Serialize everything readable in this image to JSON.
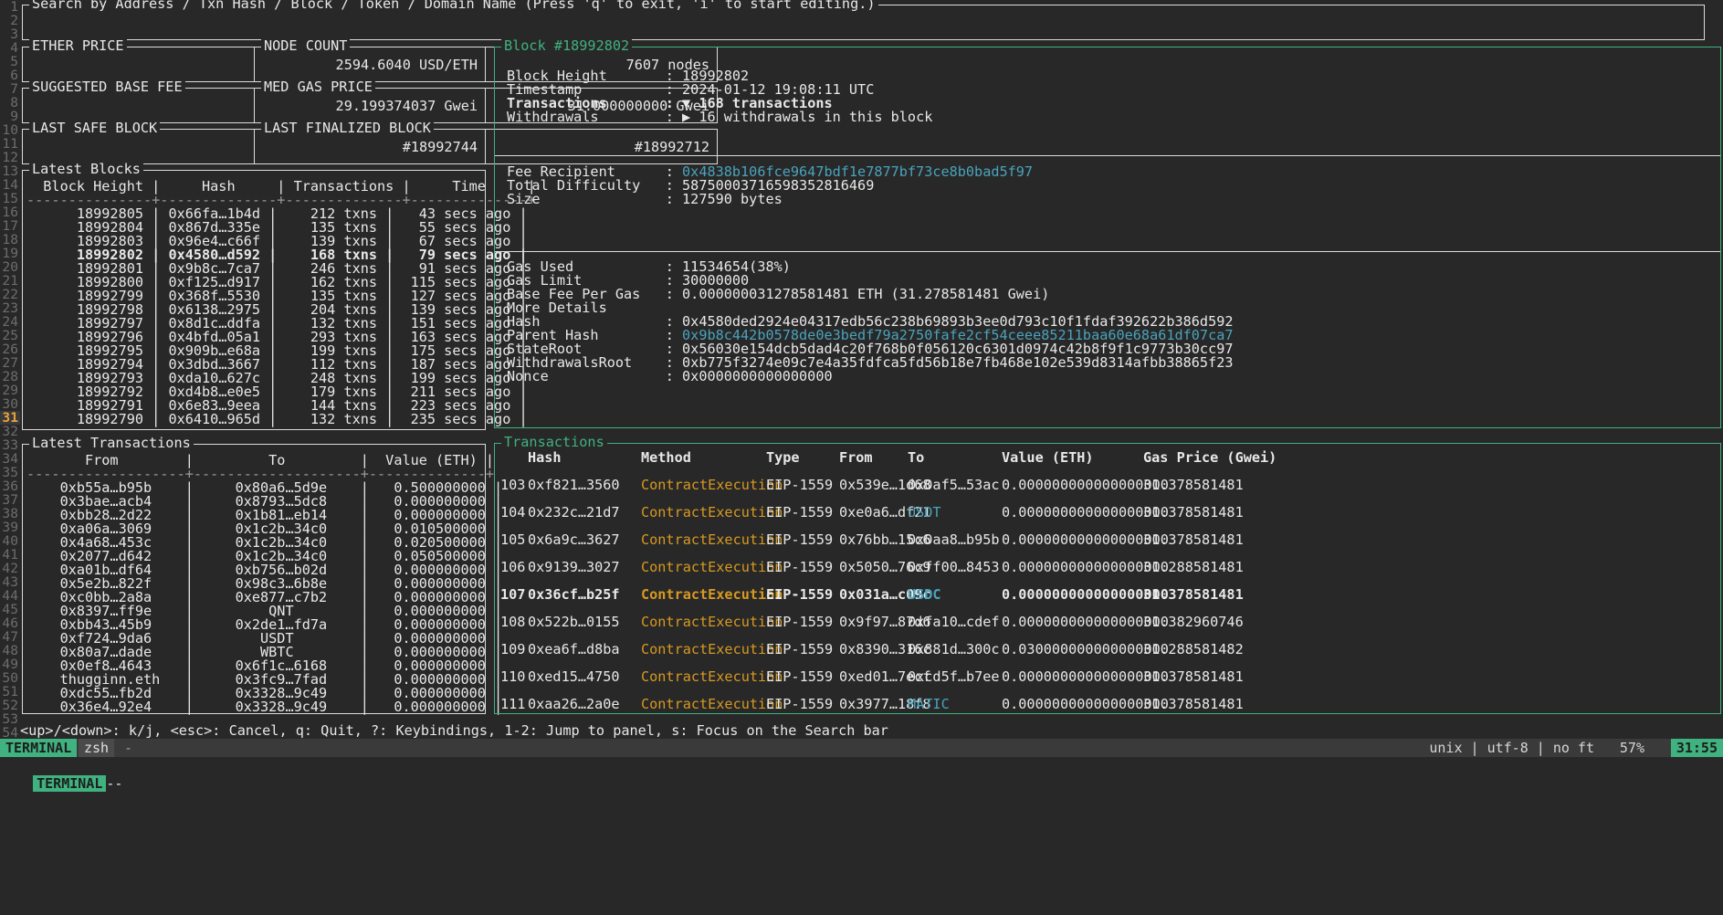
{
  "search": {
    "placeholder": "Search by Address / Txn Hash / Block / Token / Domain Name (Press 'q' to exit, 'i' to start editing.)"
  },
  "stats": {
    "ether_price": {
      "title": "ETHER PRICE",
      "value": "2594.6040 USD/ETH"
    },
    "node_count": {
      "title": "NODE COUNT",
      "value": "7607 nodes"
    },
    "suggested_base_fee": {
      "title": "SUGGESTED BASE FEE",
      "value": "29.199374037 Gwei"
    },
    "med_gas_price": {
      "title": "MED GAS PRICE",
      "value": "31.000000000 Gwei"
    },
    "last_safe_block": {
      "title": "LAST SAFE BLOCK",
      "value": "#18992744"
    },
    "last_finalized_block": {
      "title": "LAST FINALIZED BLOCK",
      "value": "#18992712"
    }
  },
  "latest_blocks": {
    "title": "Latest Blocks",
    "header": "  Block Height |     Hash     | Transactions |     Time     |",
    "separator": "---------------+--------------+--------------+--------------+",
    "rows": [
      {
        "line": "      18992805 | 0x66fa…1b4d |    212 txns |   43 secs ago |",
        "selected": false
      },
      {
        "line": "      18992804 | 0x867d…335e |    135 txns |   55 secs ago |",
        "selected": false
      },
      {
        "line": "      18992803 | 0x96e4…c66f |    139 txns |   67 secs ago |",
        "selected": false
      },
      {
        "line": "      18992802 | 0x4580…d592 |    168 txns |   79 secs ago |",
        "selected": true
      },
      {
        "line": "      18992801 | 0x9b8c…7ca7 |    246 txns |   91 secs ago |",
        "selected": false
      },
      {
        "line": "      18992800 | 0xf125…d917 |    162 txns |  115 secs ago |",
        "selected": false
      },
      {
        "line": "      18992799 | 0x368f…5530 |    135 txns |  127 secs ago |",
        "selected": false
      },
      {
        "line": "      18992798 | 0x6138…2975 |    204 txns |  139 secs ago |",
        "selected": false
      },
      {
        "line": "      18992797 | 0x8d1c…ddfa |    132 txns |  151 secs ago |",
        "selected": false
      },
      {
        "line": "      18992796 | 0x4bfd…05a1 |    293 txns |  163 secs ago |",
        "selected": false
      },
      {
        "line": "      18992795 | 0x909b…e68a |    199 txns |  175 secs ago |",
        "selected": false
      },
      {
        "line": "      18992794 | 0x3dbd…3667 |    112 txns |  187 secs ago |",
        "selected": false
      },
      {
        "line": "      18992793 | 0xda10…627c |    248 txns |  199 secs ago |",
        "selected": false
      },
      {
        "line": "      18992792 | 0xd4b8…e0e5 |    179 txns |  211 secs ago |",
        "selected": false
      },
      {
        "line": "      18992791 | 0x6e83…9eea |    144 txns |  223 secs ago |",
        "selected": false
      },
      {
        "line": "      18992790 | 0x6410…965d |    132 txns |  235 secs ago |",
        "selected": false
      }
    ]
  },
  "latest_transactions": {
    "title": "Latest Transactions",
    "header": "       From        |         To         |  Value (ETH) |",
    "separator": "-------------------+--------------------+--------------+",
    "rows": [
      "    0xb55a…b95b    |     0x80a6…5d9e    |   0.500000000 |",
      "    0x3bae…acb4    |     0x8793…5dc8    |   0.000000000 |",
      "    0xbb28…2d22    |     0x1b81…eb14    |   0.000000000 |",
      "    0xa06a…3069    |     0x1c2b…34c0    |   0.010500000 |",
      "    0x4a68…453c    |     0x1c2b…34c0    |   0.020500000 |",
      "    0x2077…d642    |     0x1c2b…34c0    |   0.050500000 |",
      "    0xa01b…df64    |     0xb756…b02d    |   0.000000000 |",
      "    0x5e2b…822f    |     0x98c3…6b8e    |   0.000000000 |",
      "    0xc0bb…2a8a    |     0xe877…c7b2    |   0.000000000 |",
      "    0x8397…ff9e    |         QNT        |   0.000000000 |",
      "    0xbb43…45b9    |     0x2de1…fd7a    |   0.000000000 |",
      "    0xf724…9da6    |        USDT        |   0.000000000 |",
      "    0x80a7…dade    |        WBTC        |   0.000000000 |",
      "    0x0ef8…4643    |     0x6f1c…6168    |   0.000000000 |",
      "    thugginn.eth   |     0x3fc9…7fad    |   0.000000000 |",
      "    0xdc55…fb2d    |     0x3328…9c49    |   0.000000000 |",
      "    0x36e4…92e4    |     0x3328…9c49    |   0.000000000 |"
    ]
  },
  "block_detail": {
    "title": "Block #18992802",
    "fields": [
      {
        "label": "Block Height",
        "value": "18992802",
        "style": "plain"
      },
      {
        "label": "Timestamp",
        "value": "2024-01-12 19:08:11 UTC",
        "style": "plain"
      },
      {
        "label": "Transactions",
        "value": "168 transactions",
        "style": "bold",
        "marker": "▼"
      },
      {
        "label": "Withdrawals",
        "value": "16 withdrawals in this block",
        "style": "plain",
        "marker": "▶"
      }
    ],
    "fields2": [
      {
        "label": "Fee Recipient",
        "value": "0x4838b106fce9647bdf1e7877bf73ce8b0bad5f97",
        "style": "link"
      },
      {
        "label": "Total Difficulty",
        "value": "58750003716598352816469",
        "style": "plain"
      },
      {
        "label": "Size",
        "value": "127590 bytes",
        "style": "plain"
      }
    ],
    "fields3": [
      {
        "label": "Gas Used",
        "value": "11534654(38%)",
        "style": "plain"
      },
      {
        "label": "Gas Limit",
        "value": "30000000",
        "style": "plain"
      },
      {
        "label": "Base Fee Per Gas",
        "value": "0.000000031278581481 ETH (31.278581481 Gwei)",
        "style": "plain"
      },
      {
        "label": "More Details",
        "value": "",
        "style": "plain"
      },
      {
        "label": "Hash",
        "value": "0x4580ded2924e04317edb56c238b69893b3ee0d793c10f1fdaf392622b386d592",
        "style": "plain"
      },
      {
        "label": "Parent Hash",
        "value": "0x9b8c442b0578de0e3bedf79a2750fafe2cf54ceee85211baa60e68a61df07ca7",
        "style": "link"
      },
      {
        "label": "StateRoot",
        "value": "0x56030e154dcb5dad4c20f768b0f056120c6301d0974c42b8f9f1c9773b30cc97",
        "style": "plain"
      },
      {
        "label": "WithdrawalsRoot",
        "value": "0xb775f3274e09c7e4a35fdfca5fd56b18e7fb468e102e539d8314afbb38865f23",
        "style": "plain"
      },
      {
        "label": "Nonce",
        "value": "0x0000000000000000",
        "style": "plain"
      }
    ]
  },
  "transactions_panel": {
    "title": "Transactions",
    "columns": [
      "Hash",
      "Method",
      "Type",
      "From",
      "To",
      "Value (ETH)",
      "Gas Price (Gwei)"
    ],
    "rows": [
      {
        "idx": "103",
        "hash": "0xf821…3560",
        "method": "ContractExecution",
        "type": "EIP-1559",
        "from": "0x539e…1d68",
        "to": "0x0af5…53ac",
        "to_token": false,
        "value": "0.000000000000000000",
        "gas": "31.378581481",
        "selected": false
      },
      {
        "idx": "104",
        "hash": "0x232c…21d7",
        "method": "ContractExecution",
        "type": "EIP-1559",
        "from": "0xe0a6…df21",
        "to": "USDT",
        "to_token": true,
        "value": "0.000000000000000000",
        "gas": "31.378581481",
        "selected": false
      },
      {
        "idx": "105",
        "hash": "0x6a9c…3627",
        "method": "ContractExecution",
        "type": "EIP-1559",
        "from": "0x76bb…15c6",
        "to": "0x0aa8…b95b",
        "to_token": false,
        "value": "0.000000000000000000",
        "gas": "31.378581481",
        "selected": false
      },
      {
        "idx": "106",
        "hash": "0x9139…3027",
        "method": "ContractExecution",
        "type": "EIP-1559",
        "from": "0x5050…76c9",
        "to": "0xff00…8453",
        "to_token": false,
        "value": "0.000000000000000000",
        "gas": "31.288581481",
        "selected": false
      },
      {
        "idx": "107",
        "hash": "0x36cf…b25f",
        "method": "ContractExecution",
        "type": "EIP-1559",
        "from": "0x031a…c09c",
        "to": "USDC",
        "to_token": true,
        "value": "0.000000000000000000",
        "gas": "31.378581481",
        "selected": true
      },
      {
        "idx": "108",
        "hash": "0x522b…0155",
        "method": "ContractExecution",
        "type": "EIP-1559",
        "from": "0x9f97…87d6",
        "to": "0xfa10…cdef",
        "to_token": false,
        "value": "0.000000000000000000",
        "gas": "31.382960746",
        "selected": false
      },
      {
        "idx": "109",
        "hash": "0xea6f…d8ba",
        "method": "ContractExecution",
        "type": "EIP-1559",
        "from": "0x8390…316c",
        "to": "0x881d…300c",
        "to_token": false,
        "value": "0.030000000000000000",
        "gas": "31.288581482",
        "selected": false
      },
      {
        "idx": "110",
        "hash": "0xed15…4750",
        "method": "ContractExecution",
        "type": "EIP-1559",
        "from": "0xed01…7ecf",
        "to": "0xcd5f…b7ee",
        "to_token": false,
        "value": "0.000000000000000000",
        "gas": "31.378581481",
        "selected": false
      },
      {
        "idx": "111",
        "hash": "0xaa26…2a0e",
        "method": "ContractExecution",
        "type": "EIP-1559",
        "from": "0x3977…18f8",
        "to": "MATIC",
        "to_token": true,
        "value": "0.000000000000000000",
        "gas": "31.378581481",
        "selected": false
      }
    ]
  },
  "help_bar": {
    "text": "<up>/<down>: k/j, <esc>: Cancel, q: Quit, ?: Keybindings, 1-2: Jump to panel, s: Focus on the Search bar"
  },
  "status_bar": {
    "session": "TERMINAL",
    "window": "zsh",
    "extra": "-",
    "encoding": "unix | utf-8 | no ft",
    "percent": "57%",
    "clock": "31:55",
    "bottom_tag": "TERMINAL",
    "bottom_rest": "--"
  },
  "gutter": {
    "current_line": 31,
    "first": 1,
    "last": 54
  },
  "colors": {
    "bg": "#282828",
    "fg": "#e8e8e8",
    "accent_green": "#3fb27f",
    "link_cyan": "#4aa3bd",
    "method_orange": "#d79921",
    "cursor_orange": "#e8a33d"
  }
}
